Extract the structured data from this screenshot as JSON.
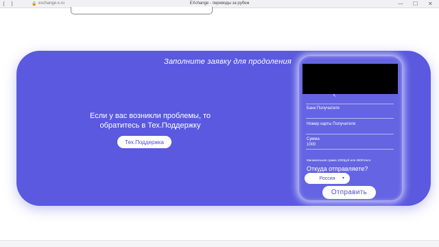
{
  "browser": {
    "url": "exchange-x.ru",
    "window_title": "EXchange - переводы за рубеж",
    "nav_back": "⟨",
    "nav_forward": "⟩",
    "lock": "🔒",
    "minimize": "—",
    "maximize": "☐",
    "close": "✕"
  },
  "panel": {
    "title": "Заполните заявку для продоления"
  },
  "support": {
    "text": "Если у вас возникли проблемы, то обратитесь в Тех.Поддержку",
    "button_label": "Тех.Поддержка"
  },
  "form": {
    "fields": [
      {
        "label": "Банк Получателя",
        "value": ""
      },
      {
        "label": "Номер карты Получателя",
        "value": ""
      },
      {
        "label": "Сумма",
        "value": "1000"
      }
    ],
    "hint": "Минимальная сумма 1000руб или 4500тенге",
    "question": "Откуда отправляете?",
    "country_selected": "Россия",
    "caret": "▾",
    "submit_label": "Отправить",
    "cursor": "↖"
  },
  "colors": {
    "accent": "#5a59e0",
    "button_text": "#4c4bd6"
  }
}
